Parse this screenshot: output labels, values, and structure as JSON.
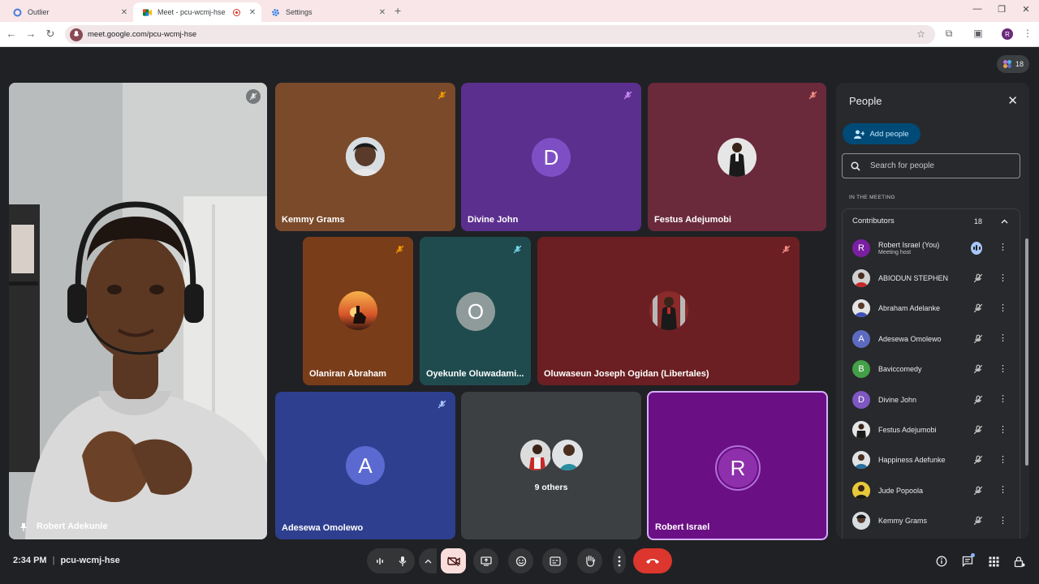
{
  "browser": {
    "tabs": [
      {
        "title": "Outlier",
        "icon": "outlier-icon"
      },
      {
        "title": "Meet - pcu-wcmj-hse",
        "icon": "meet-icon",
        "active": true,
        "recording": true
      },
      {
        "title": "Settings",
        "icon": "gear-icon"
      }
    ],
    "url": "meet.google.com/pcu-wcmj-hse",
    "profile_initial": "R"
  },
  "meeting": {
    "participant_count": "18",
    "time": "2:34 PM",
    "code": "pcu-wcmj-hse",
    "tiles": [
      {
        "name": "Robert Adekunle",
        "type": "video",
        "pinned": true
      },
      {
        "name": "Kemmy Grams",
        "type": "photo",
        "bg": "#7a4a2a",
        "muted": true
      },
      {
        "name": "Divine John",
        "type": "letter",
        "letter": "D",
        "bg": "#5b2f8e",
        "avatar": "#7e4fc4",
        "muted": true
      },
      {
        "name": "Festus Adejumobi",
        "type": "photo",
        "bg": "#6a2a3c",
        "muted": true
      },
      {
        "name": "Olaniran Abraham",
        "type": "photo",
        "bg": "#7a3d1a",
        "muted": true
      },
      {
        "name": "Oyekunle Oluwadami...",
        "type": "letter",
        "letter": "O",
        "bg": "#1f4b4f",
        "avatar": "#8f9b9b",
        "muted": true
      },
      {
        "name": "Oluwaseun Joseph Ogidan (Libertales)",
        "type": "photo",
        "bg": "#6b1f22",
        "muted": true
      },
      {
        "name": "Adesewa Omolewo",
        "type": "letter",
        "letter": "A",
        "bg": "#2f3f8f",
        "avatar": "#5b6ad0",
        "muted": true
      },
      {
        "name": "9 others",
        "type": "others",
        "bg": "#3c4043"
      },
      {
        "name": "Robert Israel",
        "type": "letter",
        "letter": "R",
        "bg": "#6a0f84",
        "avatar": "#8e2fab",
        "speaking": true
      }
    ]
  },
  "panel": {
    "title": "People",
    "add_label": "Add people",
    "search_placeholder": "Search for people",
    "section": "IN THE MEETING",
    "group_label": "Contributors",
    "group_count": "18",
    "participants": [
      {
        "name": "Robert Israel (You)",
        "sub": "Meeting host",
        "letter": "R",
        "color": "#7b1fa2",
        "speaking": true
      },
      {
        "name": "ABIODUN STEPHEN",
        "photo": true,
        "color": "#8c8c8c"
      },
      {
        "name": "Abraham Adelanke",
        "photo": true,
        "color": "#a0a0a0"
      },
      {
        "name": "Adesewa Omolewo",
        "letter": "A",
        "color": "#5c6bc0"
      },
      {
        "name": "Baviccomedy",
        "letter": "B",
        "color": "#43a047"
      },
      {
        "name": "Divine John",
        "letter": "D",
        "color": "#7e57c2"
      },
      {
        "name": "Festus Adejumobi",
        "photo": true,
        "color": "#6d6d6d"
      },
      {
        "name": "Happiness Adefunke",
        "photo": true,
        "color": "#9e9e9e"
      },
      {
        "name": "Jude Popoola",
        "photo": true,
        "color": "#c9a227"
      },
      {
        "name": "Kemmy Grams",
        "photo": true,
        "color": "#8d8d8d"
      }
    ]
  },
  "colors": {
    "meet_bg": "#202124",
    "end_call": "#dc362e",
    "add_people_bg": "#004a77",
    "cam_off_bg": "#f9dedc"
  }
}
